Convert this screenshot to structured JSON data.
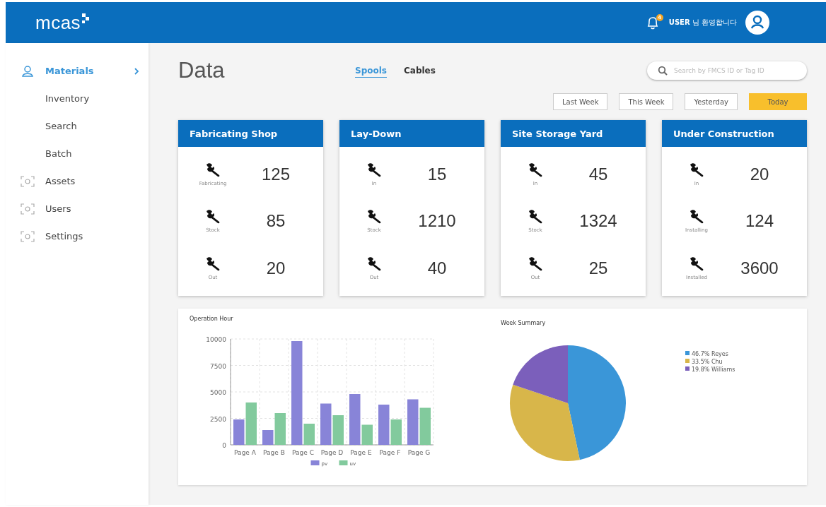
{
  "header": {
    "logo": "mcas",
    "notification_count": "4",
    "greeting_user": "USER",
    "greeting_text": "님 환영합니다"
  },
  "sidebar": {
    "items": [
      {
        "label": "Materials",
        "selected": true,
        "expanded": true,
        "children": [
          {
            "label": "Inventory"
          },
          {
            "label": "Search"
          },
          {
            "label": "Batch"
          }
        ]
      },
      {
        "label": "Assets",
        "selected": false
      },
      {
        "label": "Users",
        "selected": false
      },
      {
        "label": "Settings",
        "selected": false
      }
    ]
  },
  "page_title": "Data",
  "tabs": [
    {
      "label": "Spools",
      "selected": true
    },
    {
      "label": "Cables",
      "selected": false
    }
  ],
  "search": {
    "placeholder": "Search by FMCS ID or Tag ID"
  },
  "date_filters": [
    {
      "label": "Last Week",
      "selected": false
    },
    {
      "label": "This Week",
      "selected": false
    },
    {
      "label": "Yesterday",
      "selected": false
    },
    {
      "label": "Today",
      "selected": true
    }
  ],
  "cards": [
    {
      "title": "Fabricating Shop",
      "stats": [
        {
          "label": "Fabricating",
          "value": "125"
        },
        {
          "label": "Stock",
          "value": "85"
        },
        {
          "label": "Out",
          "value": "20"
        }
      ]
    },
    {
      "title": "Lay-Down",
      "stats": [
        {
          "label": "In",
          "value": "15"
        },
        {
          "label": "Stock",
          "value": "1210"
        },
        {
          "label": "Out",
          "value": "40"
        }
      ]
    },
    {
      "title": "Site Storage Yard",
      "stats": [
        {
          "label": "In",
          "value": "45"
        },
        {
          "label": "Stock",
          "value": "1324"
        },
        {
          "label": "Out",
          "value": "25"
        }
      ]
    },
    {
      "title": "Under Construction",
      "stats": [
        {
          "label": "In",
          "value": "20"
        },
        {
          "label": "Installing",
          "value": "124"
        },
        {
          "label": "Installed",
          "value": "3600"
        }
      ]
    }
  ],
  "charts": [
    {
      "title": "Operation Hour",
      "chart_data": {
        "type": "bar",
        "categories": [
          "Page A",
          "Page B",
          "Page C",
          "Page D",
          "Page E",
          "Page F",
          "Page G"
        ],
        "series": [
          {
            "name": "pv",
            "color": "#8884d8",
            "values": [
              2400,
              1400,
              9800,
              3900,
              4800,
              3800,
              4300
            ]
          },
          {
            "name": "uv",
            "color": "#82ca9d",
            "values": [
              4000,
              3000,
              2000,
              2800,
              1900,
              2400,
              3500
            ]
          }
        ],
        "ylim": [
          0,
          10000
        ],
        "yticks": [
          0,
          2500,
          5000,
          7500,
          10000
        ],
        "grid": true,
        "legend": true
      }
    },
    {
      "title": "Week Summary",
      "chart_data": {
        "type": "pie",
        "categories": [
          "46.7% Reyes",
          "33.5% Chu",
          "19.8% Williams"
        ],
        "values": [
          46.7,
          33.5,
          19.8
        ],
        "colors": [
          "#3a96d8",
          "#d8b64a",
          "#7b5fbb"
        ],
        "legend": true
      }
    }
  ]
}
